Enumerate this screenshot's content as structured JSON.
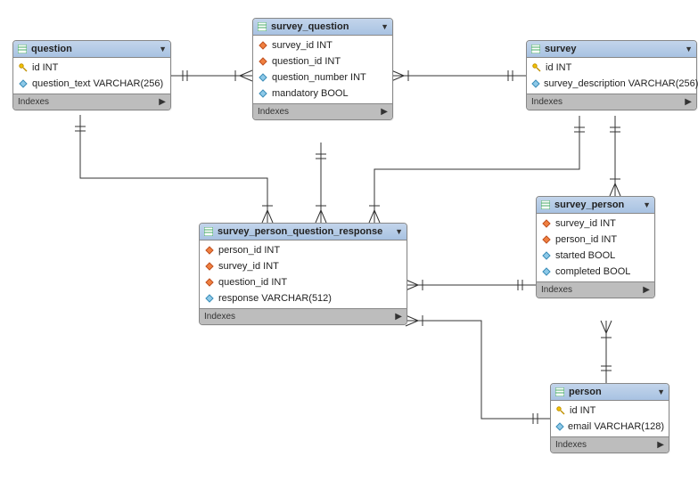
{
  "entities": {
    "question": {
      "title": "question",
      "columns": [
        {
          "icon": "key",
          "text": "id INT"
        },
        {
          "icon": "diamond",
          "text": "question_text VARCHAR(256)"
        }
      ],
      "footer": "Indexes"
    },
    "survey_question": {
      "title": "survey_question",
      "columns": [
        {
          "icon": "fk",
          "text": "survey_id INT"
        },
        {
          "icon": "fk",
          "text": "question_id INT"
        },
        {
          "icon": "diamond",
          "text": "question_number INT"
        },
        {
          "icon": "diamond",
          "text": "mandatory BOOL"
        }
      ],
      "footer": "Indexes"
    },
    "survey": {
      "title": "survey",
      "columns": [
        {
          "icon": "key",
          "text": "id INT"
        },
        {
          "icon": "diamond",
          "text": "survey_description VARCHAR(256)"
        }
      ],
      "footer": "Indexes"
    },
    "spqr": {
      "title": "survey_person_question_response",
      "columns": [
        {
          "icon": "fk",
          "text": "person_id INT"
        },
        {
          "icon": "fk",
          "text": "survey_id INT"
        },
        {
          "icon": "fk",
          "text": "question_id INT"
        },
        {
          "icon": "diamond",
          "text": "response VARCHAR(512)"
        }
      ],
      "footer": "Indexes"
    },
    "survey_person": {
      "title": "survey_person",
      "columns": [
        {
          "icon": "fk",
          "text": "survey_id INT"
        },
        {
          "icon": "fk",
          "text": "person_id INT"
        },
        {
          "icon": "diamond",
          "text": "started BOOL"
        },
        {
          "icon": "diamond",
          "text": "completed BOOL"
        }
      ],
      "footer": "Indexes"
    },
    "person": {
      "title": "person",
      "columns": [
        {
          "icon": "key",
          "text": "id INT"
        },
        {
          "icon": "diamond",
          "text": "email VARCHAR(128)"
        }
      ],
      "footer": "Indexes"
    }
  }
}
